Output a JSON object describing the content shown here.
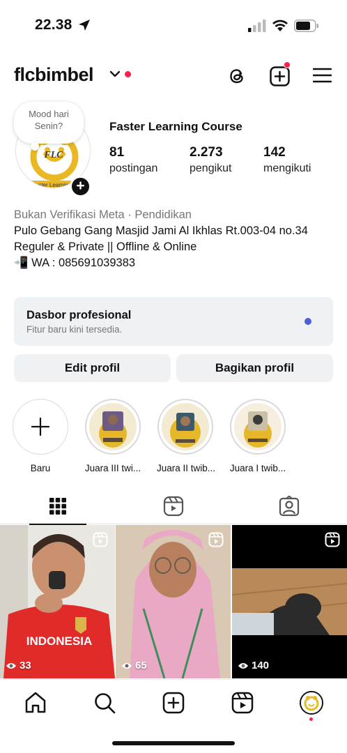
{
  "status_bar": {
    "time": "22.38"
  },
  "header": {
    "username": "flcbimbel"
  },
  "note": {
    "text": "Mood hari Senin?"
  },
  "profile": {
    "full_name": "Faster Learning Course",
    "stats": [
      {
        "value": "81",
        "label": "postingan"
      },
      {
        "value": "2.273",
        "label": "pengikut"
      },
      {
        "value": "142",
        "label": "mengikuti"
      }
    ],
    "bio": {
      "category": "Bukan Verifikasi Meta · Pendidikan",
      "lines": [
        "Pulo Gebang Gang Masjid Jami Al Ikhlas Rt.003-04 no.34",
        "Reguler & Private || Offline & Online",
        "📲 WA : 085691039383"
      ]
    }
  },
  "dashboard": {
    "title": "Dasbor profesional",
    "subtitle": "Fitur baru kini tersedia."
  },
  "buttons": {
    "edit": "Edit profil",
    "share": "Bagikan profil"
  },
  "highlights": [
    {
      "label": "Baru"
    },
    {
      "label": "Juara III twi..."
    },
    {
      "label": "Juara II twib..."
    },
    {
      "label": "Juara I twib..."
    }
  ],
  "posts": [
    {
      "views": "33"
    },
    {
      "views": "65"
    },
    {
      "views": "140"
    }
  ],
  "icons": {
    "status": [
      "location-arrow-icon",
      "signal-icon",
      "wifi-icon",
      "battery-icon"
    ],
    "header": [
      "chevron-down-icon",
      "threads-icon",
      "new-post-icon",
      "menu-icon"
    ],
    "tabs": [
      "grid-icon",
      "reels-icon",
      "tagged-icon"
    ],
    "nav": [
      "home-icon",
      "search-icon",
      "create-icon",
      "reels-icon",
      "profile-avatar"
    ]
  },
  "colors": {
    "notification_red": "#ff1f4b",
    "dashboard_dot": "#4c5fd5",
    "logo_gold": "#e9b824"
  }
}
